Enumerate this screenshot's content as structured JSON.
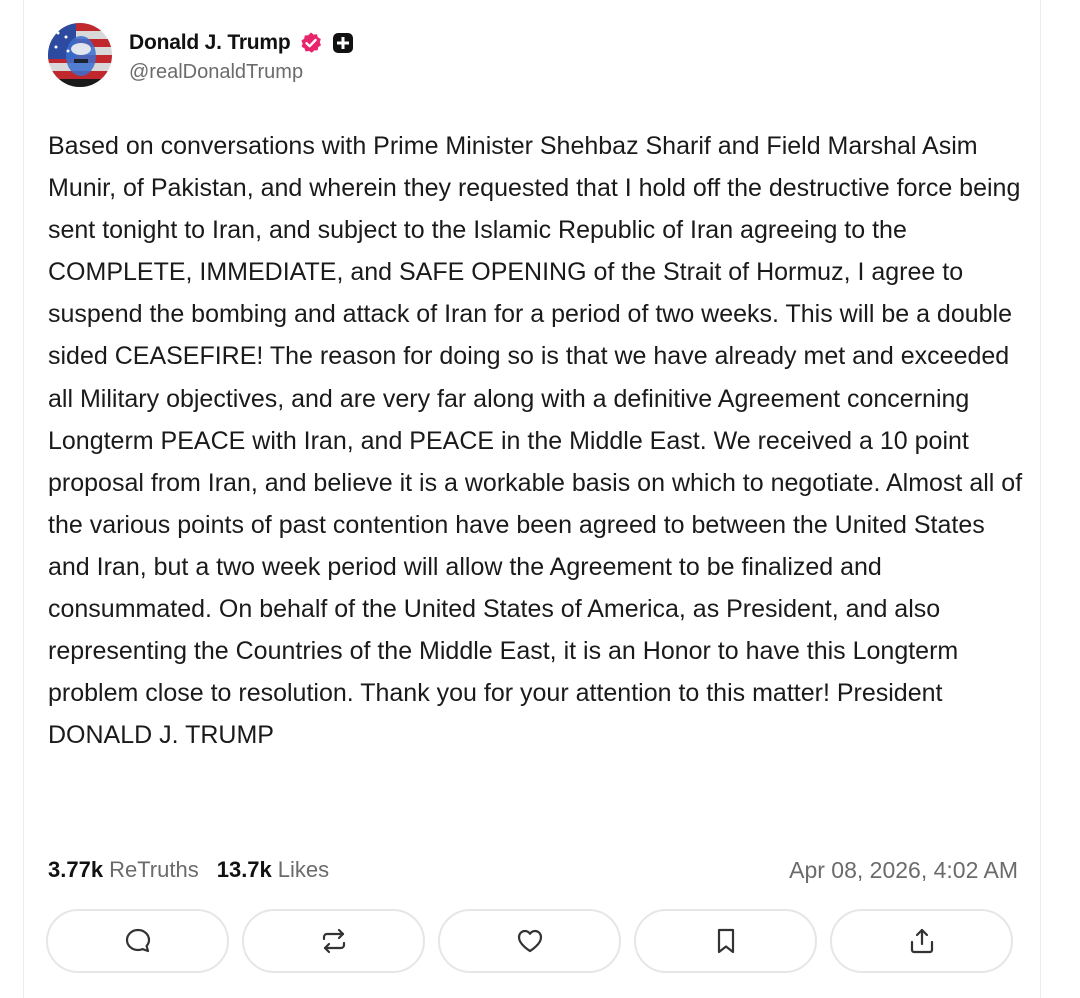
{
  "author": {
    "display_name": "Donald J. Trump",
    "handle": "@realDonaldTrump",
    "verified_icon": "verified-badge-icon",
    "plus_icon": "plus-badge-icon",
    "verified_color": "#e8246a"
  },
  "post": {
    "text": "Based on conversations with Prime Minister Shehbaz Sharif and Field Marshal Asim Munir, of Pakistan, and wherein they requested that I hold off the destructive force being sent tonight to Iran, and subject to the Islamic Republic of Iran agreeing to the COMPLETE, IMMEDIATE, and SAFE OPENING of the Strait of Hormuz, I agree to suspend the bombing and attack of Iran for a period of two weeks. This will be a double sided CEASEFIRE! The reason for doing so is that we have already met and exceeded all Military objectives, and are very far along with a definitive Agreement concerning Longterm PEACE with Iran, and PEACE in the Middle East. We received a 10 point proposal from Iran, and believe it is a workable basis on which to negotiate. Almost all of the various points of past contention have been agreed to between the United States and Iran, but a two week period will allow the Agreement to be finalized and consummated. On behalf of the United States of America, as President, and also representing the Countries of the Middle East, it is an Honor to have this Longterm problem close to resolution. Thank you for your attention to this matter! President DONALD J. TRUMP"
  },
  "stats": {
    "retruths_count": "3.77k",
    "retruths_label": "ReTruths",
    "likes_count": "13.7k",
    "likes_label": "Likes",
    "timestamp": "Apr 08, 2026, 4:02 AM"
  },
  "actions": [
    {
      "icon": "reply-icon"
    },
    {
      "icon": "retruth-icon"
    },
    {
      "icon": "like-icon"
    },
    {
      "icon": "bookmark-icon"
    },
    {
      "icon": "share-icon"
    }
  ]
}
